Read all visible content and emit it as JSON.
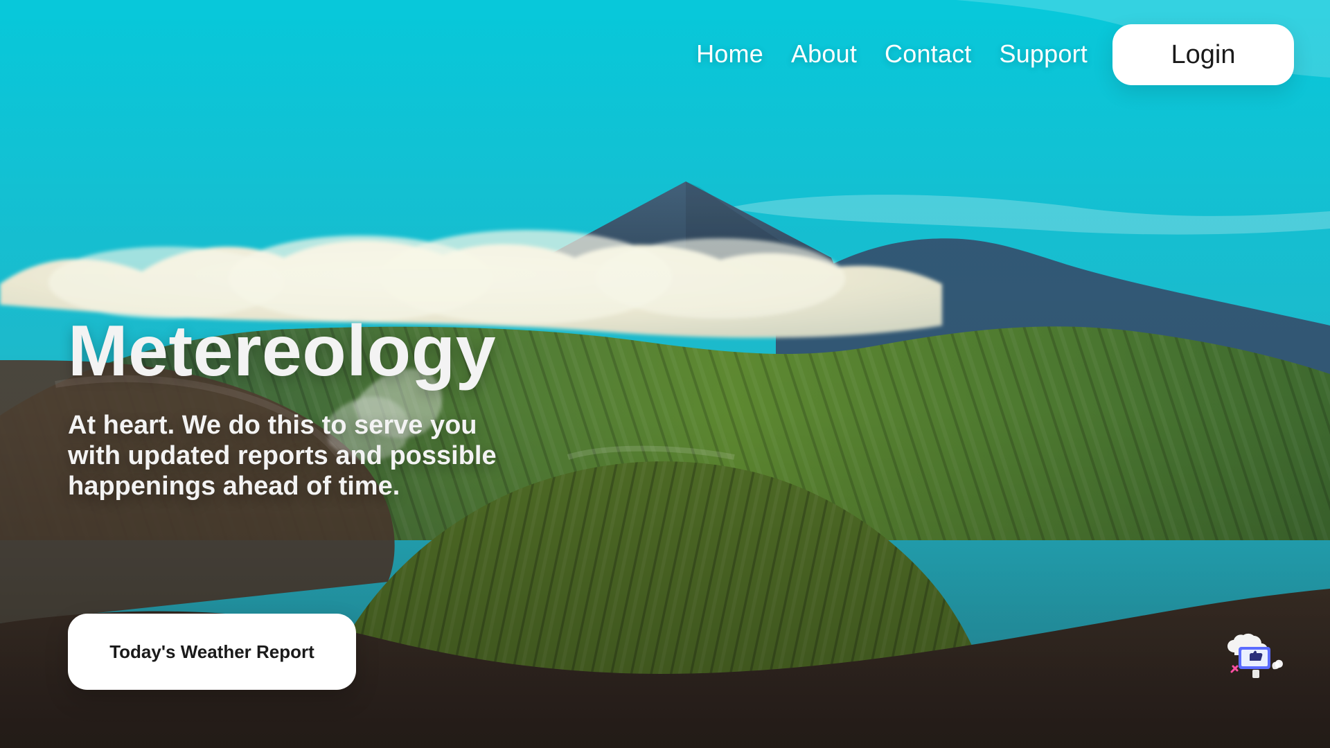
{
  "nav": {
    "items": [
      {
        "label": "Home"
      },
      {
        "label": "About"
      },
      {
        "label": "Contact"
      },
      {
        "label": "Support"
      }
    ],
    "login_label": "Login"
  },
  "hero": {
    "title": "Metereology",
    "subtitle": "At heart. We do this to serve you with updated reports and possible happenings ahead of time.",
    "cta_label": "Today's Weather Report"
  },
  "colors": {
    "sky_top": "#00c7d9",
    "sky_bottom": "#23b6c7",
    "mountain_blue": "#3d5d77",
    "mountain_green": "#6a8a2a",
    "ground_brown": "#4b3527",
    "button_bg": "#ffffff",
    "text_light": "#ffffff"
  },
  "icons": {
    "corner_illustration": "weather-illustration-icon"
  }
}
